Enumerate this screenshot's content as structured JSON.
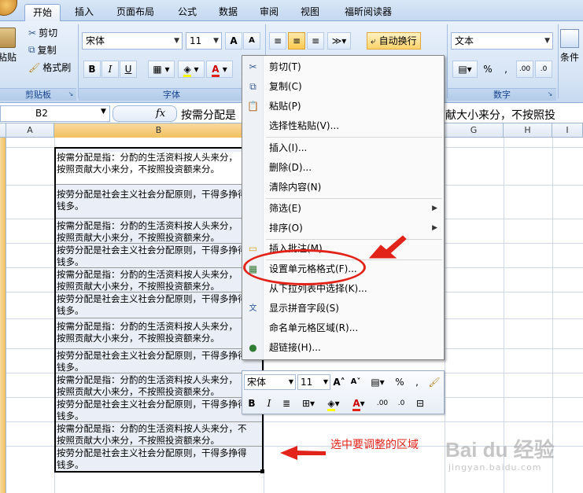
{
  "ribbon": {
    "tabs": [
      "开始",
      "插入",
      "页面布局",
      "公式",
      "数据",
      "审阅",
      "视图",
      "福昕阅读器"
    ],
    "active_tab": "开始",
    "clipboard": {
      "paste": "粘贴",
      "cut": "剪切",
      "copy": "复制",
      "format_painter": "格式刷",
      "group_label": "剪贴板"
    },
    "font": {
      "name": "宋体",
      "size": "11",
      "bold": "B",
      "italic": "I",
      "underline": "U",
      "group_label": "字体",
      "grow": "A",
      "shrink": "A"
    },
    "alignment": {
      "wrap_text": "自动换行"
    },
    "number": {
      "format": "文本",
      "percent": "%",
      "comma": ",",
      "group_label": "数字"
    },
    "styles": {
      "conditional": "条件"
    }
  },
  "formula_bar": {
    "name_box": "B2",
    "fx": "fx",
    "content": "按需分配是",
    "content_tail": "照贡献大小来分，不按照投"
  },
  "columns": [
    "A",
    "B",
    "G",
    "H",
    "I"
  ],
  "cells": [
    "按需分配是指：分酌的生活资料按人头来分，\n按照贡献大小来分，不按照投资额来分。",
    "按劳分配是社会主义社会分配原则，干得多挣得\n钱多。",
    "按需分配是指：分酌的生活资料按人头来分，\n按照贡献大小来分，不按照投资额来分。",
    "按劳分配是社会主义社会分配原则，干得多挣得\n钱多。",
    "按需分配是指：分酌的生活资料按人头来分，\n按照贡献大小来分，不按照投资额来分。",
    "按劳分配是社会主义社会分配原则，干得多挣得\n钱多。",
    "按需分配是指：分酌的生活资料按人头来分，\n按照贡献大小来分，不按照投资额来分。",
    "按劳分配是社会主义社会分配原则，干得多挣得\n钱多。",
    "按需分配是指：分酌的生活资料按人头来分，\n按照贡献大小来分，不按照投资额来分。",
    "按劳分配是社会主义社会分配原则，干得多挣得\n钱多。",
    "按需分配是指：分酌的生活资料按人头来分，不\n按照贡献大小来分，不按照投资额来分。",
    "按劳分配是社会主义社会分配原则，干得多挣得\n钱多。"
  ],
  "context_menu": [
    {
      "label": "剪切(T)",
      "icon": "scissors-icon"
    },
    {
      "label": "复制(C)",
      "icon": "copy-icon"
    },
    {
      "label": "粘贴(P)",
      "icon": "paste-icon"
    },
    {
      "label": "选择性粘贴(V)...",
      "icon": ""
    },
    {
      "label": "插入(I)...",
      "icon": ""
    },
    {
      "label": "删除(D)...",
      "icon": ""
    },
    {
      "label": "清除内容(N)",
      "icon": ""
    },
    {
      "label": "筛选(E)",
      "icon": "",
      "submenu": true
    },
    {
      "label": "排序(O)",
      "icon": "",
      "submenu": true
    },
    {
      "label": "插入批注(M)",
      "icon": "comment-icon"
    },
    {
      "label": "设置单元格格式(F)...",
      "icon": "format-cells-icon"
    },
    {
      "label": "从下拉列表中选择(K)...",
      "icon": ""
    },
    {
      "label": "显示拼音字段(S)",
      "icon": "pinyin-icon"
    },
    {
      "label": "命名单元格区域(R)...",
      "icon": ""
    },
    {
      "label": "超链接(H)...",
      "icon": "hyperlink-icon"
    }
  ],
  "mini_toolbar": {
    "font": "宋体",
    "size": "11",
    "percent": "%",
    "comma": ",",
    "bold": "B",
    "italic": "I"
  },
  "annotation": "选中要调整的区域",
  "watermark": {
    "logo": "Bai du 经验",
    "sub": "jingyan.baidu.com"
  },
  "colors": {
    "accent": "#e2231a",
    "ribbon": "#d6e4f5",
    "selection": "#eaeef6"
  }
}
